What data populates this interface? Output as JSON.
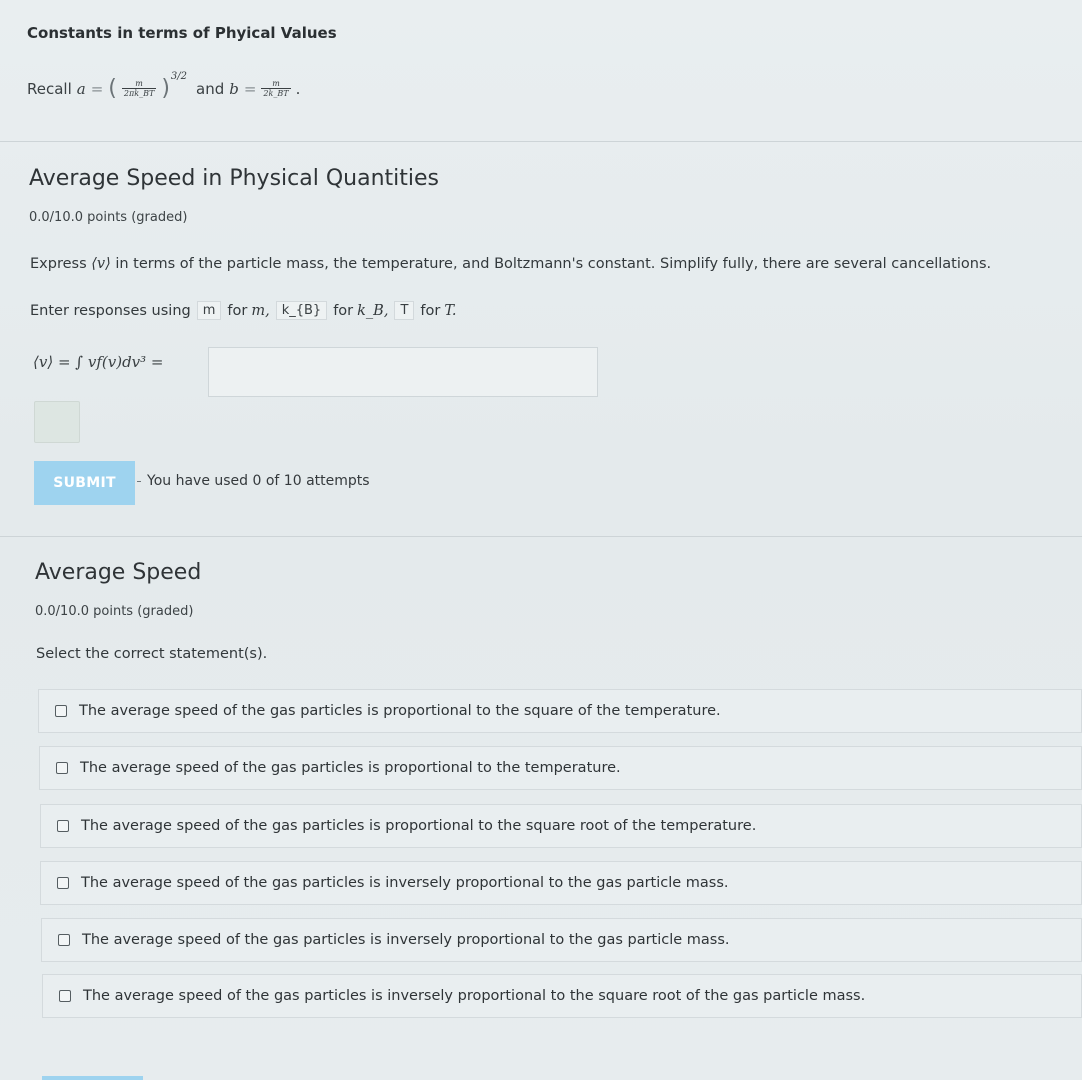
{
  "constants_section": {
    "title": "Constants in terms of Phyical Values",
    "recall_prefix": "Recall",
    "a_symbol": "a",
    "equals": "=",
    "a_numerator": "m",
    "a_denominator": "2πk_BT",
    "a_exponent": "3/2",
    "and_text": "and",
    "b_symbol": "b",
    "b_numerator": "m",
    "b_denominator": "2k_BT",
    "period": "."
  },
  "problem1": {
    "title": "Average Speed in Physical Quantities",
    "points": "0.0/10.0 points (graded)",
    "prompt_prefix": "Express",
    "prompt_symbol": "⟨v⟩",
    "prompt_rest": "in terms of the particle mass, the temperature, and Boltzmann's constant. Simplify fully, there are several cancellations.",
    "enter_prefix": "Enter responses using",
    "chip_m": "m",
    "for_m": "for",
    "sym_m": "m,",
    "chip_kb": "k_{B}",
    "for_kb": "for",
    "sym_kb": "k_B,",
    "chip_t": "T",
    "for_t": "for",
    "sym_t": "T.",
    "equation": "⟨v⟩ = ∫ vf(v)dv³ =",
    "answer_value": "",
    "submit_label": "SUBMIT",
    "attempts_text": "You have used 0 of 10 attempts"
  },
  "problem2": {
    "title": "Average Speed",
    "points": "0.0/10.0 points (graded)",
    "instruction": "Select the correct statement(s).",
    "options": [
      {
        "label": "The average speed of the gas particles is proportional to the square of the temperature.",
        "checked": false
      },
      {
        "label": "The average speed of the gas particles is proportional to the temperature.",
        "checked": false
      },
      {
        "label": "The average speed of the gas particles is proportional to the square root of the temperature.",
        "checked": false
      },
      {
        "label": "The average speed of the gas particles is inversely proportional to the gas particle mass.",
        "checked": false
      },
      {
        "label": "The average speed of the gas particles is inversely proportional to the gas particle mass.",
        "checked": false
      },
      {
        "label": "The average speed of the gas particles is inversely proportional to the square root of the gas particle mass.",
        "checked": false
      }
    ]
  },
  "colors": {
    "submit_button": "#9ed3ef",
    "background": "#e6ecee"
  }
}
